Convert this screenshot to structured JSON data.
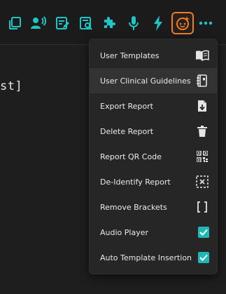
{
  "toolbar": {
    "buttons": [
      {
        "name": "copy-icon"
      },
      {
        "name": "speaker-icon"
      },
      {
        "name": "report-edit-icon"
      },
      {
        "name": "report-search-icon"
      },
      {
        "name": "puzzle-icon"
      },
      {
        "name": "microphone-icon"
      },
      {
        "name": "lightning-icon"
      },
      {
        "name": "assistant-face-icon",
        "active": true
      },
      {
        "name": "more-options-icon"
      }
    ],
    "accent_color": "#1fc5c5",
    "active_border_color": "#f07c2a"
  },
  "editor": {
    "visible_text": "st]"
  },
  "menu": {
    "items": [
      {
        "label": "User Templates",
        "icon": "book-icon"
      },
      {
        "label": "User Clinical Guidelines",
        "icon": "guideline-book-icon",
        "hovered": true
      },
      {
        "label": "Export Report",
        "icon": "file-download-icon"
      },
      {
        "label": "Delete Report",
        "icon": "trash-icon"
      },
      {
        "label": "Report QR Code",
        "icon": "qr-code-icon"
      },
      {
        "label": "De-Identify Report",
        "icon": "de-identify-icon"
      },
      {
        "label": "Remove Brackets",
        "icon": "brackets-icon"
      },
      {
        "label": "Audio Player",
        "icon": "checkbox-checked-icon",
        "checked": true
      },
      {
        "label": "Auto Template Insertion",
        "icon": "checkbox-checked-icon",
        "checked": true
      }
    ],
    "checkbox_color": "#1fb8b8"
  }
}
